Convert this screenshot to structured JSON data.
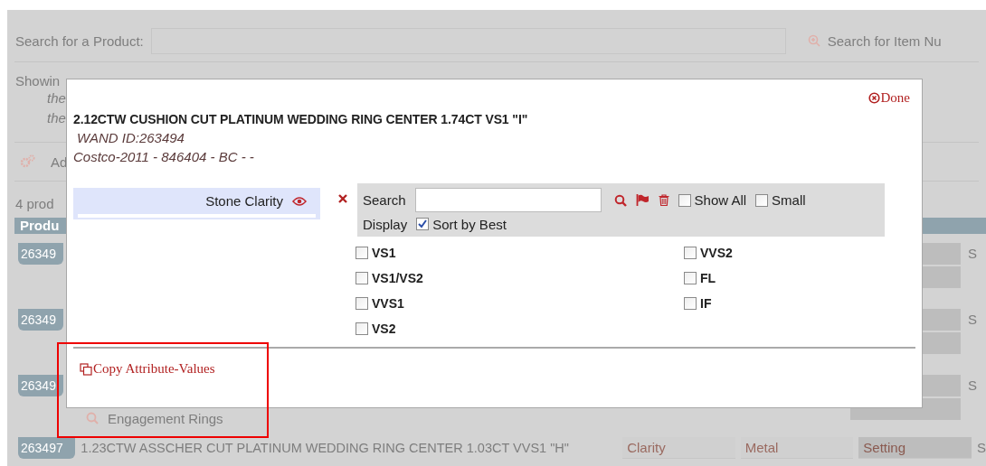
{
  "background": {
    "search_label": "Search for a Product:",
    "item_search_label": "Search for Item Nu",
    "showing_text": "Showin",
    "note_lines": [
      "the",
      "the"
    ],
    "action_label": "Ad",
    "count_text": "4 prod",
    "table_header": "Produ",
    "rows": [
      {
        "badge": "26349",
        "column_s": "S"
      },
      {
        "badge": "26349",
        "column_s": "S"
      },
      {
        "badge": "26349",
        "column_s": "S"
      }
    ],
    "category": "Engagement Rings",
    "last_row": {
      "badge": "263497",
      "title": "1.23CTW ASSCHER CUT PLATINUM WEDDING RING CENTER 1.03CT VVS1 \"H\"",
      "cells": [
        "Clarity",
        "Metal",
        "Setting"
      ],
      "column_s": "S"
    }
  },
  "modal": {
    "done": "Done",
    "title": "2.12CTW CUSHION CUT PLATINUM WEDDING RING CENTER 1.74CT VS1 \"I\"",
    "wand_id": "WAND ID:263494",
    "source": "Costco-2011 - 846404 - BC - -",
    "attributes": [
      {
        "label": "Stone Clarity",
        "selected": true
      }
    ],
    "filter": {
      "search_label": "Search",
      "show_all": {
        "label": "Show All",
        "checked": false
      },
      "small": {
        "label": "Small",
        "checked": false
      },
      "display_label": "Display",
      "sort_best": {
        "label": "Sort by Best",
        "checked": true
      }
    },
    "options": [
      {
        "label": "VS1",
        "checked": false
      },
      {
        "label": "VVS2",
        "checked": false
      },
      {
        "label": "VS1/VS2",
        "checked": false
      },
      {
        "label": "FL",
        "checked": false
      },
      {
        "label": "VVS1",
        "checked": false
      },
      {
        "label": "IF",
        "checked": false
      },
      {
        "label": "VS2",
        "checked": false
      }
    ],
    "copy_link": "Copy Attribute-Values"
  }
}
